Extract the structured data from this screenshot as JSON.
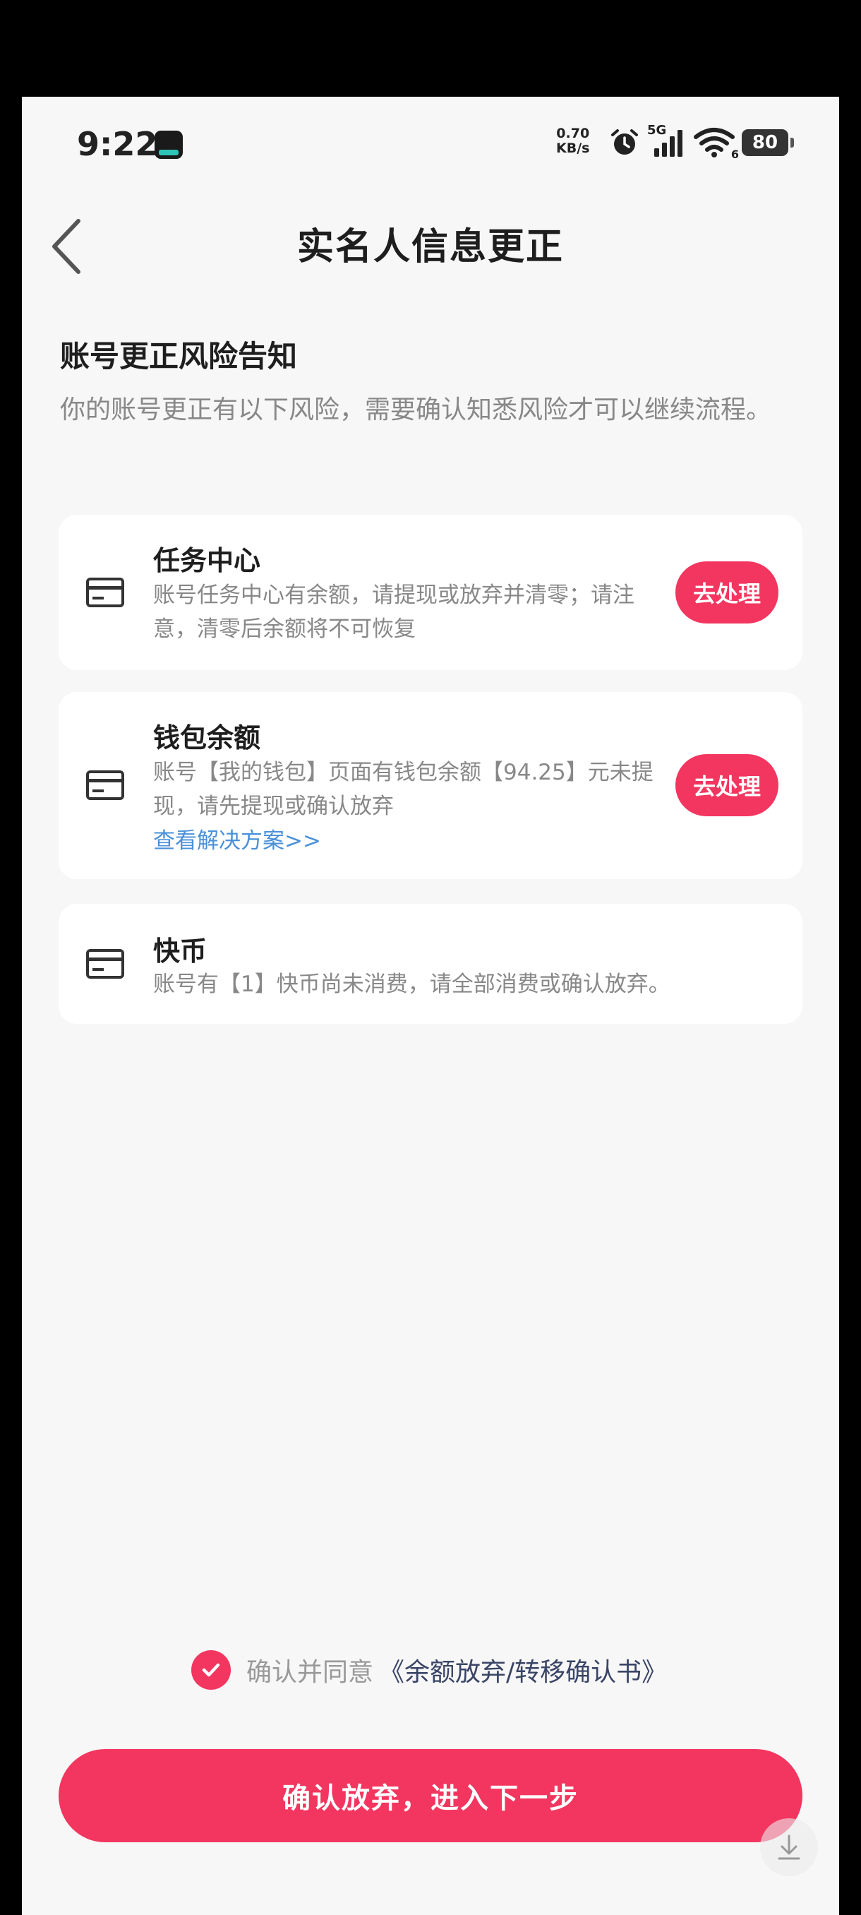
{
  "status_bar": {
    "time": "9:22",
    "net_speed_value": "0.70",
    "net_speed_unit": "KB/s",
    "network": "5G",
    "wifi_sub": "6",
    "battery": "80"
  },
  "header": {
    "title": "实名人信息更正"
  },
  "notice": {
    "title": "账号更正风险告知",
    "description": "你的账号更正有以下风险，需要确认知悉风险才可以继续流程。"
  },
  "cards": [
    {
      "title": "任务中心",
      "description": "账号任务中心有余额，请提现或放弃并清零；请注意，清零后余额将不可恢复",
      "button": "去处理"
    },
    {
      "title": "钱包余额",
      "description": "账号【我的钱包】页面有钱包余额【94.25】元未提现，请先提现或确认放弃",
      "link": "查看解决方案>>",
      "button": "去处理"
    },
    {
      "title": "快币",
      "description": "账号有【1】快币尚未消费，请全部消费或确认放弃。"
    }
  ],
  "agreement": {
    "text": "确认并同意",
    "link": "《余额放弃/转移确认书》",
    "checked": true
  },
  "confirm_button": "确认放弃，进入下一步",
  "colors": {
    "accent": "#f2365f",
    "link": "#4a90d9",
    "background": "#f7f7f7"
  }
}
